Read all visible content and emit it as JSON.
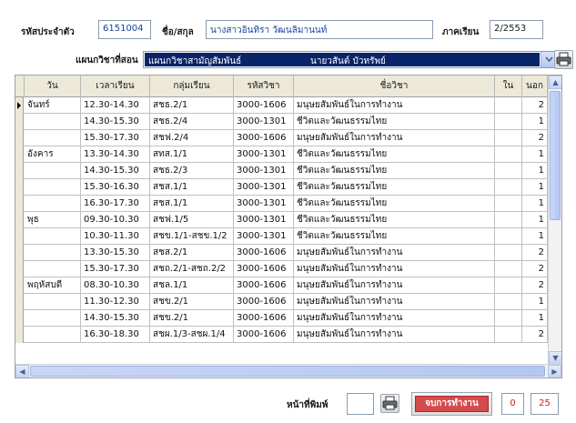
{
  "form": {
    "id_label": "รหัสประจำตัว",
    "id_value": "6151004",
    "name_label": "ชื่อ/สกุล",
    "name_value": "นางสาวอินทิรา  วัฒนลิมานนท์",
    "term_label": "ภาคเรียน",
    "term_value": "2/2553",
    "dept_label": "แผนกวิชาที่สอน",
    "dept_value": "แผนกวิชาสามัญสัมพันธ์",
    "dept_teacher": "นายวสันต์  บัวทรัพย์"
  },
  "table": {
    "columns": [
      "วัน",
      "เวลาเรียน",
      "กลุ่มเรียน",
      "รหัสวิชา",
      "ชื่อวิชา",
      "ใน",
      "นอก"
    ],
    "rows": [
      {
        "day": "จันทร์",
        "time": "12.30-14.30",
        "group": "สชธ.2/1",
        "code": "3000-1606",
        "subject": "มนุษยสัมพันธ์ในการทำงาน",
        "in": "",
        "out": "2"
      },
      {
        "day": "",
        "time": "14.30-15.30",
        "group": "สชธ.2/4",
        "code": "3000-1301",
        "subject": "ชีวิตและวัฒนธรรมไทย",
        "in": "",
        "out": "1"
      },
      {
        "day": "",
        "time": "15.30-17.30",
        "group": "สชฟ.2/4",
        "code": "3000-1606",
        "subject": "มนุษยสัมพันธ์ในการทำงาน",
        "in": "",
        "out": "2"
      },
      {
        "day": "อังคาร",
        "time": "13.30-14.30",
        "group": "สทส.1/1",
        "code": "3000-1301",
        "subject": "ชีวิตและวัฒนธรรมไทย",
        "in": "",
        "out": "1"
      },
      {
        "day": "",
        "time": "14.30-15.30",
        "group": "สชธ.2/3",
        "code": "3000-1301",
        "subject": "ชีวิตและวัฒนธรรมไทย",
        "in": "",
        "out": "1"
      },
      {
        "day": "",
        "time": "15.30-16.30",
        "group": "สชส.1/1",
        "code": "3000-1301",
        "subject": "ชีวิตและวัฒนธรรมไทย",
        "in": "",
        "out": "1"
      },
      {
        "day": "",
        "time": "16.30-17.30",
        "group": "สชส.1/1",
        "code": "3000-1301",
        "subject": "ชีวิตและวัฒนธรรมไทย",
        "in": "",
        "out": "1"
      },
      {
        "day": "พุธ",
        "time": "09.30-10.30",
        "group": "สชฟ.1/5",
        "code": "3000-1301",
        "subject": "ชีวิตและวัฒนธรรมไทย",
        "in": "",
        "out": "1"
      },
      {
        "day": "",
        "time": "10.30-11.30",
        "group": "สชข.1/1-สชข.1/2",
        "code": "3000-1301",
        "subject": "ชีวิตและวัฒนธรรมไทย",
        "in": "",
        "out": "1"
      },
      {
        "day": "",
        "time": "13.30-15.30",
        "group": "สชส.2/1",
        "code": "3000-1606",
        "subject": "มนุษยสัมพันธ์ในการทำงาน",
        "in": "",
        "out": "2"
      },
      {
        "day": "",
        "time": "15.30-17.30",
        "group": "สชถ.2/1-สชถ.2/2",
        "code": "3000-1606",
        "subject": "มนุษยสัมพันธ์ในการทำงาน",
        "in": "",
        "out": "2"
      },
      {
        "day": "พฤหัสบดี",
        "time": "08.30-10.30",
        "group": "สชล.1/1",
        "code": "3000-1606",
        "subject": "มนุษยสัมพันธ์ในการทำงาน",
        "in": "",
        "out": "2"
      },
      {
        "day": "",
        "time": "11.30-12.30",
        "group": "สชข.2/1",
        "code": "3000-1606",
        "subject": "มนุษยสัมพันธ์ในการทำงาน",
        "in": "",
        "out": "1"
      },
      {
        "day": "",
        "time": "14.30-15.30",
        "group": "สชข.2/1",
        "code": "3000-1606",
        "subject": "มนุษยสัมพันธ์ในการทำงาน",
        "in": "",
        "out": "1"
      },
      {
        "day": "",
        "time": "16.30-18.30",
        "group": "สชผ.1/3-สชผ.1/4",
        "code": "3000-1606",
        "subject": "มนุษยสัมพันธ์ในการทำงาน",
        "in": "",
        "out": "2"
      }
    ]
  },
  "footer": {
    "print_page_label": "หน้าที่พิมพ์",
    "print_page_value": "",
    "end_button_label": "จบการทำงาน",
    "counter_1": "0",
    "counter_2": "25"
  },
  "icons": {
    "print": "printer-icon",
    "dropdown": "chevron-down-icon",
    "row_pointer": "row-pointer-icon"
  }
}
